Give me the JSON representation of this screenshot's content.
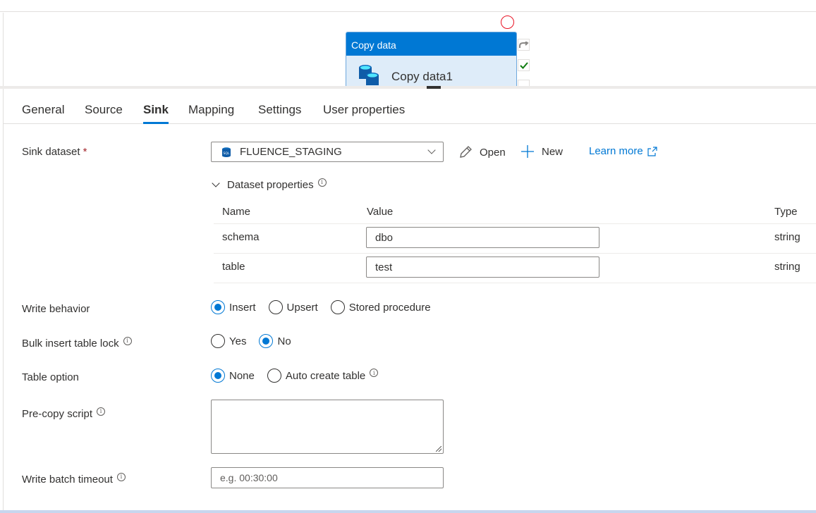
{
  "canvas": {
    "activity_type": "Copy data",
    "activity_name": "Copy data1",
    "side_icons": [
      "redo-icon",
      "validate-check-icon"
    ]
  },
  "tabs": [
    {
      "label": "General",
      "active": false
    },
    {
      "label": "Source",
      "active": false
    },
    {
      "label": "Sink",
      "active": true
    },
    {
      "label": "Mapping",
      "active": false
    },
    {
      "label": "Settings",
      "active": false
    },
    {
      "label": "User properties",
      "active": false
    }
  ],
  "sink": {
    "dataset_label": "Sink dataset",
    "required_mark": "*",
    "dataset_value": "FLUENCE_STAGING",
    "dataset_icon": "sql-database-icon",
    "open_label": "Open",
    "new_label": "New",
    "learn_more_label": "Learn more",
    "dataset_properties_label": "Dataset properties",
    "table_headers": {
      "name": "Name",
      "value": "Value",
      "type": "Type"
    },
    "properties": [
      {
        "name": "schema",
        "value": "dbo",
        "type": "string"
      },
      {
        "name": "table",
        "value": "test",
        "type": "string"
      }
    ],
    "write_behavior": {
      "label": "Write behavior",
      "options": [
        "Insert",
        "Upsert",
        "Stored procedure"
      ],
      "selected": "Insert"
    },
    "bulk_lock": {
      "label": "Bulk insert table lock",
      "options": [
        "Yes",
        "No"
      ],
      "selected": "No"
    },
    "table_option": {
      "label": "Table option",
      "options": [
        "None",
        "Auto create table"
      ],
      "selected": "None"
    },
    "pre_copy_script": {
      "label": "Pre-copy script",
      "value": ""
    },
    "write_batch_timeout": {
      "label": "Write batch timeout",
      "placeholder": "e.g. 00:30:00",
      "value": ""
    }
  },
  "colors": {
    "accent": "#0078d4",
    "required": "#a4262c",
    "activity_header": "#0078d4",
    "activity_body": "#deecf9"
  }
}
